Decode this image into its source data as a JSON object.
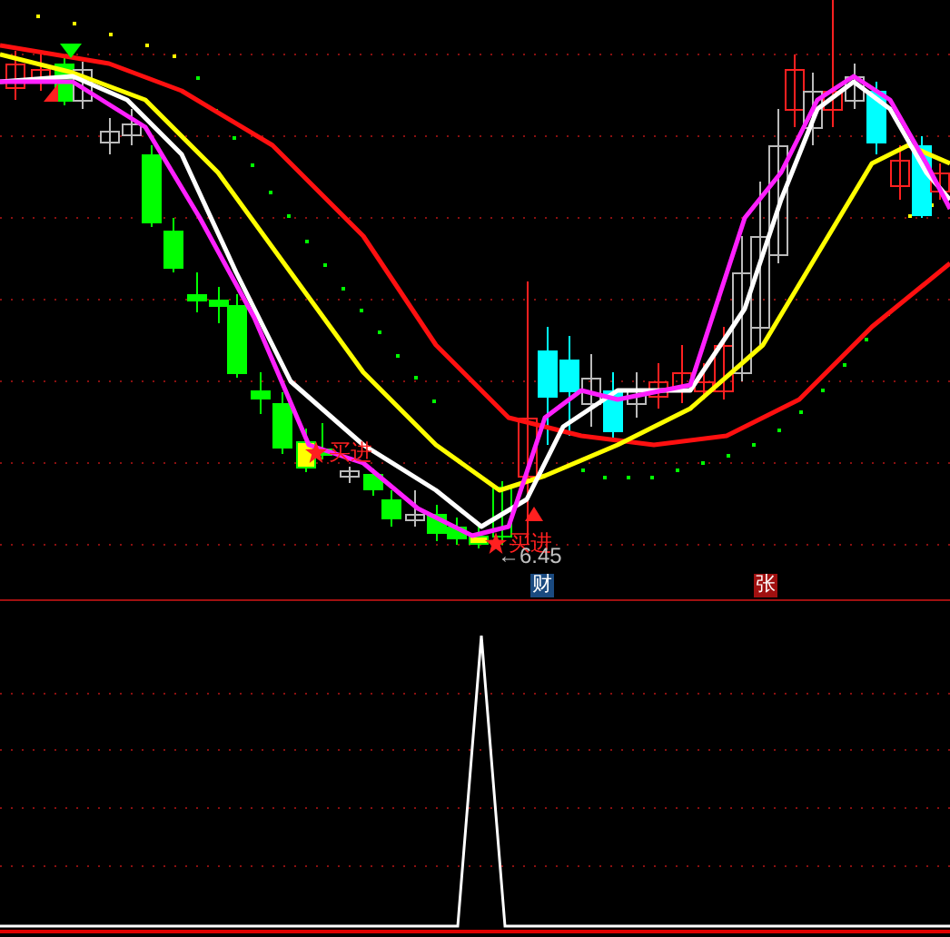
{
  "price_panel": {
    "signals": [
      {
        "kind": "buy",
        "label": "买进"
      },
      {
        "kind": "buy",
        "label": "买进"
      }
    ],
    "price_marker": {
      "arrow": "←",
      "value": "6.45"
    },
    "event_badges": [
      {
        "kind": "finance",
        "label": "财"
      },
      {
        "kind": "limit_up",
        "label": "张"
      }
    ]
  }
}
